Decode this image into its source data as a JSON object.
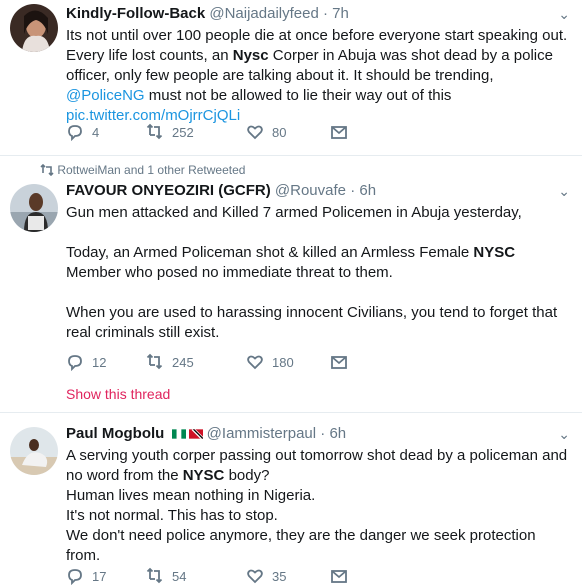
{
  "tweets": [
    {
      "name": "Kindly-Follow-Back",
      "handle": "@Naijadailyfeed",
      "dot": "·",
      "time": "7h",
      "text_parts": [
        "Its not until over 100 people die at once before everyone start speaking out. Every life lost counts, an ",
        "Nysc",
        " Corper in Abuja was shot dead by a police officer, only few people are talking about it. It should be trending, ",
        "@PoliceNG",
        " must not be allowed to lie their way out of this ",
        "pic.twitter.com/mOjrrCjQLi"
      ],
      "replies": "4",
      "retweets": "252",
      "likes": "80"
    },
    {
      "retweet_note": "RottweiMan and 1 other Retweeted",
      "name": "FAVOUR ONYEOZIRI (GCFR)",
      "handle": "@Rouvafe",
      "dot": "·",
      "time": "6h",
      "text_parts": [
        "Gun men attacked and Killed 7 armed Policemen in Abuja yesterday,\n\nToday, an Armed Policeman shot & killed an Armless Female ",
        "NYSC",
        " Member who posed no immediate threat to them.\n\nWhen you are used to harassing innocent Civilians, you tend to forget that real criminals still exist."
      ],
      "replies": "12",
      "retweets": "245",
      "likes": "180",
      "show_thread": "Show this thread"
    },
    {
      "name": "Paul Mogbolu",
      "handle": "@Iammisterpaul",
      "dot": "·",
      "time": "6h",
      "text_parts": [
        "A serving youth corper passing out tomorrow shot dead by a policeman and no word from the ",
        "NYSC",
        " body?\nHuman lives mean nothing in Nigeria.\nIt's not normal. This has to stop.\nWe don't need police anymore, they are the danger we seek protection from."
      ],
      "replies": "17",
      "retweets": "54",
      "likes": "35"
    }
  ],
  "colors": {
    "link": "#1b95e0",
    "show_thread": "#e0245e",
    "meta": "#657786",
    "divider": "#e6ecf0"
  },
  "icons": [
    "reply-icon",
    "retweet-icon",
    "like-icon",
    "dm-icon",
    "caret-down-icon",
    "retweeted-icon",
    "nigeria-flag-icon",
    "trinidad-flag-icon"
  ]
}
